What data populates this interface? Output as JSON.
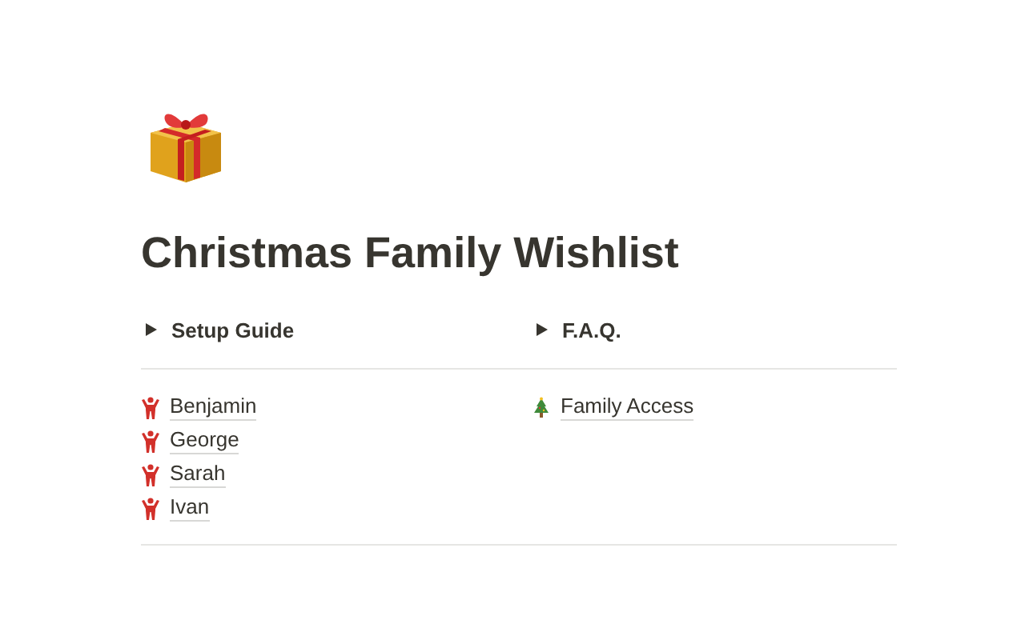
{
  "title": "Christmas Family Wishlist",
  "toggles": [
    {
      "label": "Setup Guide",
      "expanded": false
    },
    {
      "label": "F.A.Q.",
      "expanded": false
    }
  ],
  "columns": [
    [
      {
        "label": "Benjamin",
        "kind": "person"
      },
      {
        "label": "George",
        "kind": "person"
      },
      {
        "label": "Sarah",
        "kind": "person"
      },
      {
        "label": "Ivan",
        "kind": "person"
      }
    ],
    [
      {
        "label": "Family Access",
        "kind": "tree"
      }
    ]
  ]
}
